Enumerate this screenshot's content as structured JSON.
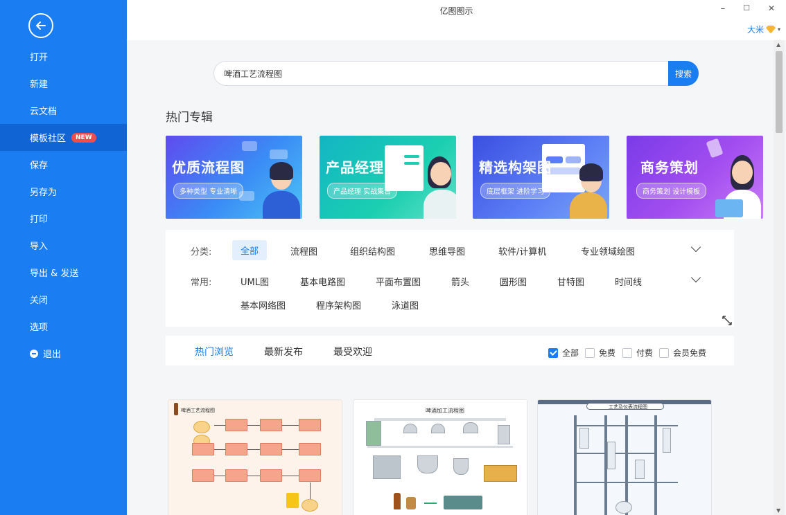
{
  "window": {
    "title": "亿图图示",
    "minimize": "–",
    "maximize": "☐",
    "close": "✕"
  },
  "user": {
    "name": "大米",
    "caret": "▾"
  },
  "sidebar": {
    "items": [
      {
        "label": "打开"
      },
      {
        "label": "新建"
      },
      {
        "label": "云文档"
      },
      {
        "label": "模板社区",
        "badge": "NEW"
      },
      {
        "label": "保存"
      },
      {
        "label": "另存为"
      },
      {
        "label": "打印"
      },
      {
        "label": "导入"
      },
      {
        "label": "导出 & 发送"
      },
      {
        "label": "关闭"
      },
      {
        "label": "选项"
      },
      {
        "label": "退出"
      }
    ]
  },
  "search": {
    "value": "啤酒工艺流程图",
    "button": "搜索"
  },
  "hot": {
    "title": "热门专辑",
    "banners": [
      {
        "title": "优质流程图",
        "subtitle": "多种类型 专业清晰",
        "color": "#3a7ff0"
      },
      {
        "title": "产品经理",
        "subtitle": "产品经理 实战集合",
        "color": "#18c7b6"
      },
      {
        "title": "精选构架图",
        "subtitle": "底层框架 进阶学习",
        "color": "#4f69f0"
      },
      {
        "title": "商务策划",
        "subtitle": "商务策划 设计模板",
        "color": "#9b46e8"
      }
    ]
  },
  "filters": {
    "category_label": "分类:",
    "categories": [
      "全部",
      "流程图",
      "组织结构图",
      "思维导图",
      "软件/计算机",
      "专业领域绘图"
    ],
    "common_label": "常用:",
    "common_row1": [
      "UML图",
      "基本电路图",
      "平面布置图",
      "箭头",
      "圆形图",
      "甘特图",
      "时间线"
    ],
    "common_row2": [
      "基本网络图",
      "程序架构图",
      "泳道图"
    ]
  },
  "tabs": {
    "items": [
      "热门浏览",
      "最新发布",
      "最受欢迎"
    ],
    "checkboxes": [
      {
        "label": "全部",
        "checked": true
      },
      {
        "label": "免费",
        "checked": false
      },
      {
        "label": "付费",
        "checked": false
      },
      {
        "label": "会员免费",
        "checked": false
      }
    ]
  },
  "cards": [
    {
      "title": "啤酒工艺流程图"
    },
    {
      "title": "啤酒加工流程图"
    },
    {
      "title": "工艺及仪表流程图"
    }
  ]
}
